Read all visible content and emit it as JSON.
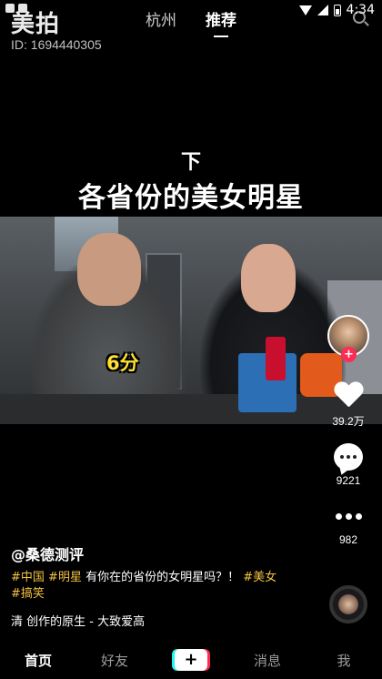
{
  "status_bar": {
    "time": "4:34"
  },
  "watermark": {
    "logo": "美拍",
    "id": "ID: 1694440305"
  },
  "top_tabs": [
    {
      "label": "杭州",
      "active": false
    },
    {
      "label": "推荐",
      "active": true
    }
  ],
  "video": {
    "caption_top": "下",
    "caption_main": "各省份的美女明星",
    "overlay_label": "6分"
  },
  "actions": {
    "like_count": "39.2万",
    "comment_count": "9221",
    "share_count": "982"
  },
  "post": {
    "author": "@桑德测评",
    "tags": [
      "#中国",
      "#明星",
      "#美女",
      "#搞笑"
    ],
    "text": "有你在的省份的女明星吗？！",
    "music": "清 创作的原生 - 大致爱高"
  },
  "bottom_nav": {
    "home": "首页",
    "friends": "好友",
    "plus": "+",
    "messages": "消息",
    "me": "我"
  },
  "colors": {
    "accent_red": "#fe2c55",
    "accent_cyan": "#25f4ee",
    "tag_yellow": "#f5c242"
  }
}
